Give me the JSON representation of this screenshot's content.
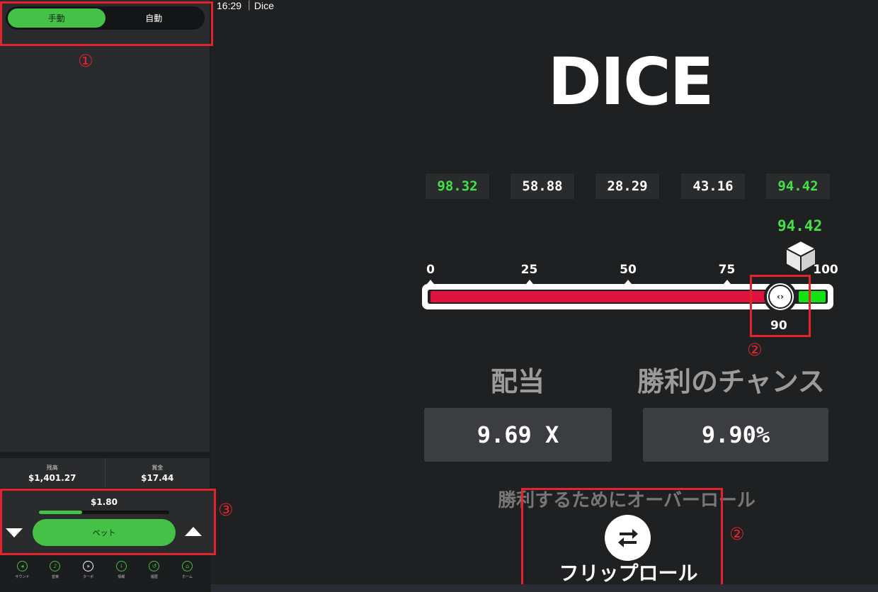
{
  "window": {
    "title": "16:29 ｜Dice"
  },
  "sidebar": {
    "mode_tabs": [
      {
        "label": "手動",
        "active": true
      },
      {
        "label": "自動",
        "active": false
      }
    ],
    "balance": {
      "label": "残高",
      "value": "$1,401.27"
    },
    "winnings": {
      "label": "賞金",
      "value": "$17.44"
    },
    "bet": {
      "amount": "$1.80",
      "button_label": "ベット",
      "slider_level": 0.33
    },
    "nav": [
      {
        "label": "サウンド",
        "icon": "speaker-icon"
      },
      {
        "label": "音楽",
        "icon": "music-icon"
      },
      {
        "label": "ターボ",
        "icon": "turbo-icon"
      },
      {
        "label": "情報",
        "icon": "info-icon"
      },
      {
        "label": "履歴",
        "icon": "history-icon"
      },
      {
        "label": "ホーム",
        "icon": "home-icon"
      }
    ]
  },
  "game": {
    "logo": "DICE",
    "history": [
      {
        "value": "98.32",
        "win": true
      },
      {
        "value": "58.88",
        "win": false
      },
      {
        "value": "28.29",
        "win": false
      },
      {
        "value": "43.16",
        "win": false
      },
      {
        "value": "94.42",
        "win": true
      }
    ],
    "current_roll": "94.42",
    "slider": {
      "ticks": [
        "0",
        "25",
        "50",
        "75",
        "100"
      ],
      "threshold": 90,
      "threshold_label": "90",
      "roll_value": 94.42
    },
    "multiplier": {
      "label": "配当",
      "value": "9.69 X"
    },
    "chance": {
      "label": "勝利のチャンス",
      "value": "9.90%"
    },
    "roll_over_text": "勝利するためにオーバーロール",
    "flip_label": "フリップロール"
  },
  "annotations": [
    "①",
    "②",
    "②",
    "③"
  ],
  "colors": {
    "accent_green": "#44c146",
    "win_green": "#44e244",
    "lose_red": "#e0133f",
    "annotation_red": "#e3232e"
  }
}
